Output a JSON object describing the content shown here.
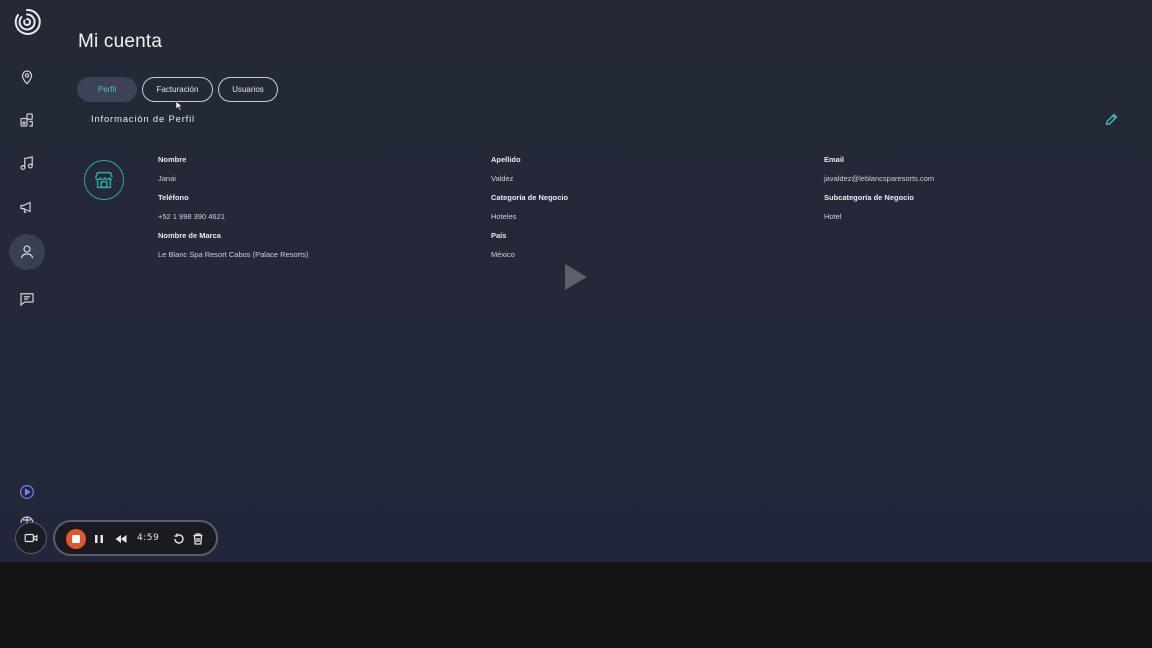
{
  "page": {
    "title": "Mi cuenta"
  },
  "sidebar": {
    "items": [
      {
        "name": "locations",
        "icon": "map-pin-icon"
      },
      {
        "name": "devices",
        "icon": "speaker-device-icon"
      },
      {
        "name": "music",
        "icon": "music-note-icon"
      },
      {
        "name": "announcements",
        "icon": "megaphone-icon"
      },
      {
        "name": "account",
        "icon": "user-icon",
        "active": true
      },
      {
        "name": "messages",
        "icon": "chat-icon"
      }
    ],
    "bottom": [
      {
        "name": "play-video",
        "icon": "play-circle-icon"
      },
      {
        "name": "language",
        "icon": "globe-icon"
      }
    ]
  },
  "tabs": [
    {
      "label": "Perfil",
      "active": true
    },
    {
      "label": "Facturación",
      "active": false
    },
    {
      "label": "Usuarios",
      "active": false
    }
  ],
  "profile": {
    "section_title": "Información de Perfil",
    "fields": {
      "nombre": {
        "label": "Nombre",
        "value": "Janai"
      },
      "apellido": {
        "label": "Apellido",
        "value": "Valdez"
      },
      "email": {
        "label": "Email",
        "value": "javaldez@leblancsparesorts.com"
      },
      "telefono": {
        "label": "Teléfono",
        "value": "+52 1 998 390 4621"
      },
      "categoria": {
        "label": "Categoría de Negocio",
        "value": "Hoteles"
      },
      "subcategoria": {
        "label": "Subcategoría de Negocio",
        "value": "Hotel"
      },
      "marca": {
        "label": "Nombre de Marca",
        "value": "Le Blanc Spa Resort Cabos (Palace Resorts)"
      },
      "pais": {
        "label": "País",
        "value": "México"
      }
    }
  },
  "recorder": {
    "time": "4:59"
  },
  "colors": {
    "accent": "#3ec8c0",
    "background": "#252936",
    "record": "#e2572d"
  }
}
